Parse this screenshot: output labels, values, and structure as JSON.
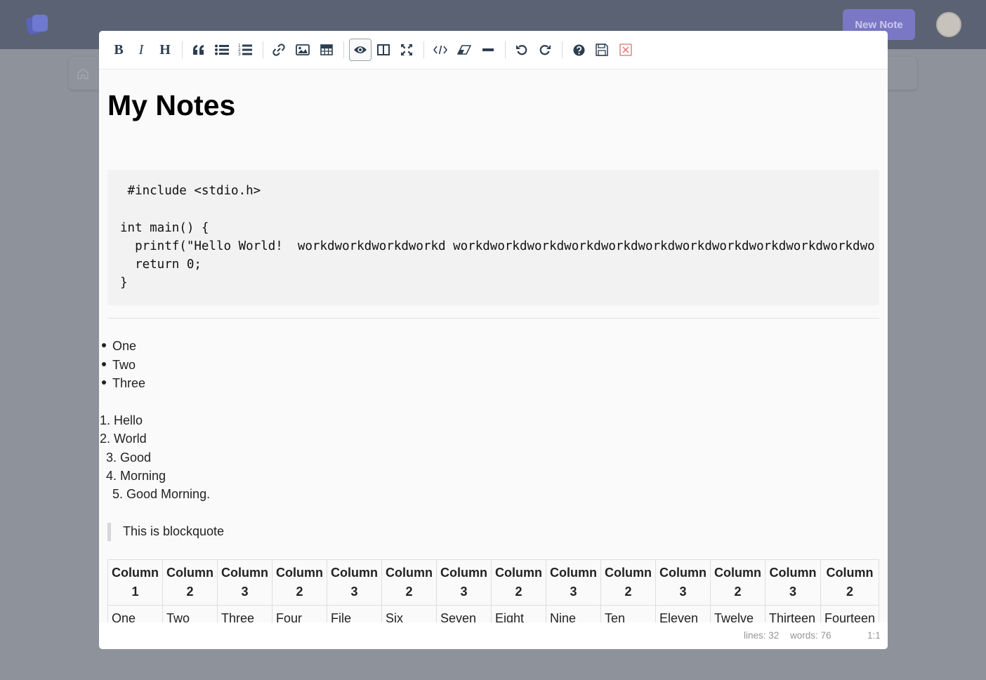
{
  "app": {
    "new_note_label": "New Note"
  },
  "toolbar": {
    "bold_label": "B",
    "italic_label": "I",
    "heading_label": "H"
  },
  "note": {
    "title": "My Notes",
    "code_lines": [
      " #include <stdio.h>",
      "",
      "int main() {",
      "  printf(\"Hello World!  workdworkdworkdworkd workdworkdworkdworkdworkdworkdworkdworkdworkdworkdworkdwo",
      "  return 0;",
      "}"
    ],
    "bullets": [
      "One",
      "Two",
      "Three"
    ],
    "ordered": [
      "1. Hello",
      "2. World",
      "3. Good",
      "4. Morning",
      "5. Good Morning."
    ],
    "blockquote": "This is blockquote",
    "table": {
      "headers": [
        [
          "Column",
          "1"
        ],
        [
          "Column",
          "2"
        ],
        [
          "Column",
          "3"
        ],
        [
          "Column",
          "2"
        ],
        [
          "Column",
          "3"
        ],
        [
          "Column",
          "2"
        ],
        [
          "Column",
          "3"
        ],
        [
          "Column",
          "2"
        ],
        [
          "Column",
          "3"
        ],
        [
          "Column",
          "2"
        ],
        [
          "Column",
          "3"
        ],
        [
          "Column",
          "2"
        ],
        [
          "Column",
          "3"
        ],
        [
          "Column",
          "2"
        ]
      ],
      "row": [
        "One",
        "Two",
        "Three",
        "Four",
        "File",
        "Six",
        "Seven",
        "Eight",
        "Nine",
        "Ten",
        "Eleven",
        "Twelve",
        "Thirteen",
        "Fourteen"
      ]
    }
  },
  "status": {
    "lines": "lines: 32",
    "words": "words: 76",
    "cursor": "1:1"
  },
  "colors": {
    "overlay": "#8e929b",
    "appbar": "#5b6273",
    "accent": "#7a78c4",
    "close_icon": "#e06c6c"
  },
  "icons": [
    "bold-icon",
    "italic-icon",
    "heading-icon",
    "quote-icon",
    "unordered-list-icon",
    "ordered-list-icon",
    "link-icon",
    "image-icon",
    "table-icon",
    "eye-icon",
    "columns-icon",
    "fullscreen-icon",
    "code-icon",
    "eraser-icon",
    "horizontal-rule-icon",
    "undo-icon",
    "redo-icon",
    "help-icon",
    "save-icon",
    "close-icon"
  ]
}
